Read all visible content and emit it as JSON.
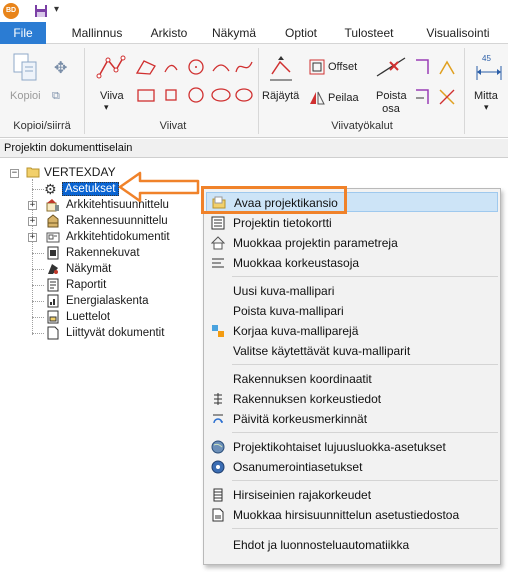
{
  "quick_access": {
    "app_icon_text": "BD"
  },
  "tabs": [
    {
      "label": "File"
    },
    {
      "label": "Mallinnus"
    },
    {
      "label": "Arkisto"
    },
    {
      "label": "Näkymä"
    },
    {
      "label": "Optiot"
    },
    {
      "label": "Tulosteet"
    },
    {
      "label": "Visualisointi"
    }
  ],
  "ribbon": {
    "groups": {
      "copy_move": "Kopioi/siirrä",
      "lines": "Viivat",
      "line_tools": "Viivatyökalut"
    },
    "buttons": {
      "copy": "Kopioi",
      "line": "Viiva",
      "explode": "Räjäytä",
      "offset": "Offset",
      "mirror": "Peilaa",
      "delete_part": "Poista osa",
      "measure": "Mitta",
      "measure_value": "45"
    }
  },
  "panel_title": "Projektin dokumenttiselain",
  "tree": {
    "root": "VERTEXDAY",
    "items": [
      {
        "label": "Asetukset",
        "selected": true,
        "expandable": false
      },
      {
        "label": "Arkkitehtisuunnittelu",
        "expandable": true
      },
      {
        "label": "Rakennesuunnittelu",
        "expandable": true
      },
      {
        "label": "Arkkitehtidokumentit",
        "expandable": true
      },
      {
        "label": "Rakennekuvat",
        "expandable": false
      },
      {
        "label": "Näkymät",
        "expandable": false
      },
      {
        "label": "Raportit",
        "expandable": false
      },
      {
        "label": "Energialaskenta",
        "expandable": false
      },
      {
        "label": "Luettelot",
        "expandable": false
      },
      {
        "label": "Liittyvät dokumentit",
        "expandable": false
      }
    ]
  },
  "context_menu": {
    "items": [
      {
        "label": "Avaa projektikansio",
        "highlighted": true
      },
      {
        "label": "Projektin tietokortti"
      },
      {
        "label": "Muokkaa projektin parametreja"
      },
      {
        "label": "Muokkaa korkeustasoja"
      },
      {
        "label": "Uusi kuva-mallipari"
      },
      {
        "label": "Poista kuva-mallipari"
      },
      {
        "label": "Korjaa kuva-malliparejä"
      },
      {
        "label": "Valitse käytettävät kuva-malliparit"
      },
      {
        "label": "Rakennuksen koordinaatit"
      },
      {
        "label": "Rakennuksen korkeustiedot"
      },
      {
        "label": "Päivitä korkeusmerkinnät"
      },
      {
        "label": "Projektikohtaiset lujuusluokka-asetukset"
      },
      {
        "label": "Osanumerointiasetukset"
      },
      {
        "label": "Hirsiseinien rajakorkeudet"
      },
      {
        "label": "Muokkaa hirsisuunnittelun asetustiedostoa"
      },
      {
        "label": "Ehdot ja luonnosteluautomatiikka"
      }
    ]
  },
  "colors": {
    "file_tab": "#2b7cd3",
    "selection": "#0a64d2",
    "callout": "#f0822a",
    "menu_highlight": "#cde4f7"
  }
}
